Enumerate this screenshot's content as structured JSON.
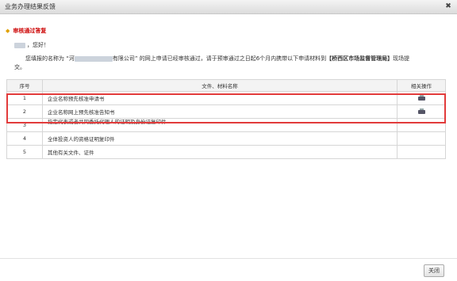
{
  "window": {
    "title": "业务办理结果反馈",
    "close_symbol": "✖"
  },
  "status": {
    "marker": "◆",
    "text": "审核通过答复",
    "color": "#cc0000"
  },
  "greeting": {
    "text": "，您好！"
  },
  "message": {
    "part1": "您填报的名称为 “河",
    "part2": "有限公司” 的网上申请已经审核通过，请于预审通过之日起6个月内携带以下申请材料到",
    "office": "【桥西区市场监督管理局】",
    "part3": "现场提",
    "line2": "交。"
  },
  "table": {
    "headers": [
      "序号",
      "文件、材料名称",
      "相关操作"
    ],
    "rows": [
      {
        "num": "1",
        "name": "企业名称预先核准申请书",
        "printable": true
      },
      {
        "num": "2",
        "name": "企业名称网上预先核准告知书",
        "printable": true
      },
      {
        "num": "3",
        "name": "指定代表或者共同委托代理人的证明及身份证复印件",
        "printable": false
      },
      {
        "num": "4",
        "name": "全体投资人的资格证明复印件",
        "printable": false
      },
      {
        "num": "5",
        "name": "其他有关文件、证件",
        "printable": false
      }
    ]
  },
  "icons": {
    "print": "printer-icon",
    "close": "close-icon"
  },
  "highlight_color": "#e23b3b",
  "footer": {
    "close_button": "关闭"
  }
}
